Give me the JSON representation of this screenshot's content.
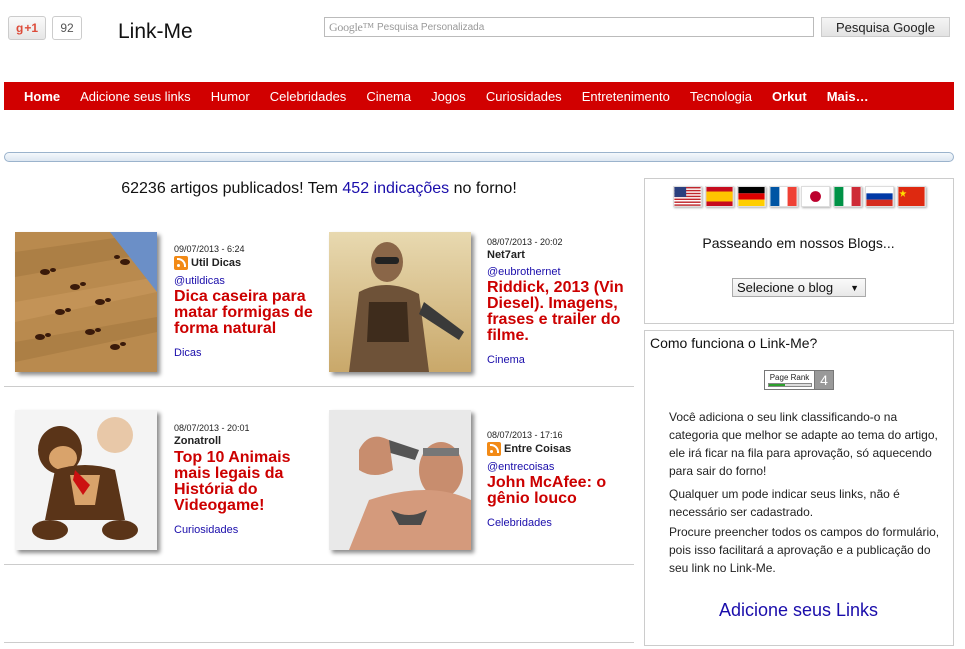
{
  "header": {
    "gplus_label": "+1",
    "gplus_count": "92",
    "site_title": "Link-Me",
    "search_brand": "Google™",
    "search_placeholder": "Pesquisa Personalizada",
    "search_button": "Pesquisa Google"
  },
  "nav": {
    "items": [
      {
        "label": "Home",
        "bold": true
      },
      {
        "label": "Adicione seus links",
        "bold": false
      },
      {
        "label": "Humor",
        "bold": false
      },
      {
        "label": "Celebridades",
        "bold": false
      },
      {
        "label": "Cinema",
        "bold": false
      },
      {
        "label": "Jogos",
        "bold": false
      },
      {
        "label": "Curiosidades",
        "bold": false
      },
      {
        "label": "Entretenimento",
        "bold": false
      },
      {
        "label": "Tecnologia",
        "bold": false
      },
      {
        "label": "Orkut",
        "bold": true
      },
      {
        "label": "Mais…",
        "bold": true
      }
    ],
    "color": "#d10000"
  },
  "stats": {
    "prefix": "62236 artigos publicados! Tem ",
    "link": "452 indicações",
    "suffix": " no forno!"
  },
  "articles": [
    {
      "date": "09/07/2013 - 6:24",
      "source": "Util Dicas",
      "rss": true,
      "handle": "@utildicas",
      "title": "Dica caseira para matar formigas de forma natural",
      "category": "Dicas"
    },
    {
      "date": "08/07/2013 - 20:02",
      "source": "Net7art",
      "rss": false,
      "handle": "@eubrothernet",
      "title": "Riddick, 2013 (Vin Diesel). Imagens, frases e trailer do filme.",
      "category": "Cinema"
    },
    {
      "date": "08/07/2013 - 20:01",
      "source": "Zonatroll",
      "rss": false,
      "handle": "",
      "title": "Top 10 Animais mais legais da História do Videogame!",
      "category": "Curiosidades"
    },
    {
      "date": "08/07/2013 - 17:16",
      "source": "Entre Coisas",
      "rss": true,
      "handle": "@entrecoisas",
      "title": "John McAfee: o gênio louco",
      "category": "Celebridades"
    }
  ],
  "sidebar": {
    "flags": [
      "us-flag-icon",
      "es-flag-icon",
      "de-flag-icon",
      "fr-flag-icon",
      "jp-flag-icon",
      "it-flag-icon",
      "ru-flag-icon",
      "cn-flag-icon"
    ],
    "passeando": "Passeando em nossos Blogs...",
    "blog_select": "Selecione o blog",
    "como_title": "Como funciona o Link-Me?",
    "pagerank_label": "Page Rank",
    "pagerank_value": "4",
    "pagerank_fraction": 0.4,
    "paragraph1": "Você adiciona o seu link classificando-o na categoria que melhor se adapte ao tema do artigo, ele irá ficar na fila para aprovação, só aquecendo para sair do forno!",
    "paragraph2": "Qualquer um pode indicar seus links, não é necessário ser cadastrado.",
    "paragraph3": "Procure preencher todos os campos do formulário, pois isso facilitará a aprovação e a publicação do seu link no Link-Me.",
    "adicione_link": "Adicione seus Links"
  }
}
